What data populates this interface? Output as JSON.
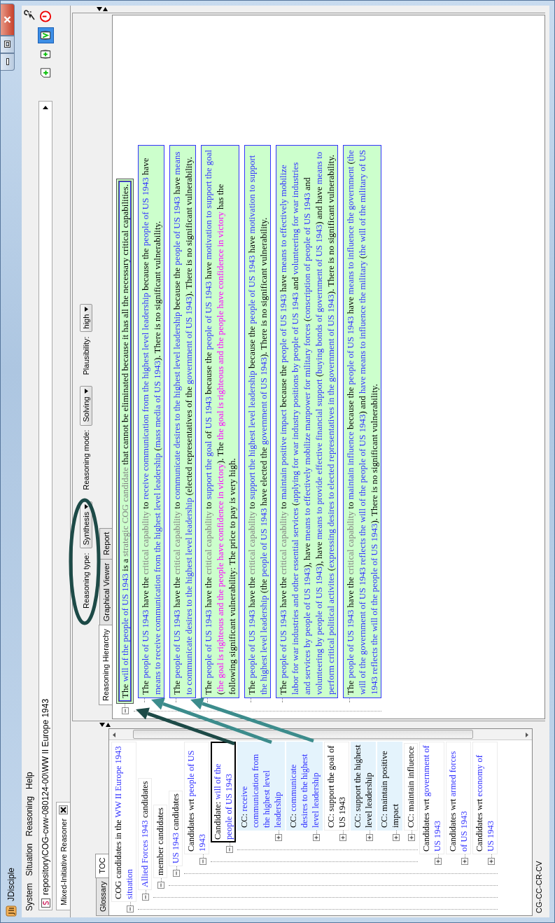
{
  "window": {
    "title": "JDisciple"
  },
  "menu": [
    "System",
    "Situation",
    "Reasoning",
    "Help"
  ],
  "path_field": {
    "value": "repository\\COG-cww-080124-00\\WW II Europe 1943"
  },
  "toolbar": [
    {
      "kind": "new-document",
      "selected": false
    },
    {
      "kind": "add-step",
      "selected": false
    },
    {
      "kind": "check-step",
      "selected": true
    },
    {
      "kind": "stop",
      "selected": false
    }
  ],
  "document_tabs": [
    {
      "label": "Mixed-Initiative Reasoner",
      "selected": true,
      "closable": true
    }
  ],
  "left_panel": {
    "tabs": [
      {
        "label": "Glossary",
        "selected": false
      },
      {
        "label": "TOC",
        "selected": true
      }
    ],
    "tree": [
      {
        "expanded": true,
        "selected": false,
        "highlighted": false,
        "segments": [
          {
            "text": "COG candidates in the ",
            "kind": "plain"
          },
          {
            "text": "WW II Europe 1943 situation",
            "kind": "concept"
          }
        ],
        "children": [
          {
            "expanded": true,
            "selected": false,
            "highlighted": false,
            "segments": [
              {
                "text": "Allied Forces 1943",
                "kind": "concept"
              },
              {
                "text": " candidates",
                "kind": "plain"
              }
            ],
            "children": [
              {
                "expanded": true,
                "selected": false,
                "highlighted": false,
                "segments": [
                  {
                    "text": "member candidates",
                    "kind": "plain"
                  }
                ],
                "children": [
                  {
                    "expanded": true,
                    "selected": false,
                    "highlighted": false,
                    "segments": [
                      {
                        "text": "US 1943",
                        "kind": "concept"
                      },
                      {
                        "text": " candidates",
                        "kind": "plain"
                      }
                    ],
                    "children": [
                      {
                        "expanded": true,
                        "selected": false,
                        "highlighted": false,
                        "segments": [
                          {
                            "text": "Candidates wrt ",
                            "kind": "plain"
                          },
                          {
                            "text": "people of US 1943",
                            "kind": "concept"
                          }
                        ],
                        "children": [
                          {
                            "expanded": true,
                            "selected": true,
                            "highlighted": false,
                            "segments": [
                              {
                                "text": "Candidate: ",
                                "kind": "plain"
                              },
                              {
                                "text": "will of the people of US 1943",
                                "kind": "concept"
                              }
                            ],
                            "children": [
                              {
                                "expanded": false,
                                "selected": false,
                                "highlighted": true,
                                "segments": [
                                  {
                                    "text": "CC: ",
                                    "kind": "plain"
                                  },
                                  {
                                    "text": "receive communication from the highest level leadership",
                                    "kind": "concept"
                                  }
                                ]
                              },
                              {
                                "expanded": false,
                                "selected": false,
                                "highlighted": true,
                                "segments": [
                                  {
                                    "text": "CC: ",
                                    "kind": "plain"
                                  },
                                  {
                                    "text": "communicate desires to the highest level leadership",
                                    "kind": "concept"
                                  }
                                ]
                              },
                              {
                                "expanded": false,
                                "selected": false,
                                "highlighted": false,
                                "segments": [
                                  {
                                    "text": "CC: support the goal of US 1943",
                                    "kind": "plain"
                                  }
                                ]
                              },
                              {
                                "expanded": false,
                                "selected": false,
                                "highlighted": true,
                                "segments": [
                                  {
                                    "text": "CC: support the highest level leadership",
                                    "kind": "plain"
                                  }
                                ]
                              },
                              {
                                "expanded": false,
                                "selected": false,
                                "highlighted": true,
                                "segments": [
                                  {
                                    "text": "CC: maintain positive impact",
                                    "kind": "plain"
                                  }
                                ]
                              },
                              {
                                "expanded": false,
                                "selected": false,
                                "highlighted": false,
                                "segments": [
                                  {
                                    "text": "CC: maintain influence",
                                    "kind": "plain"
                                  }
                                ]
                              }
                            ]
                          }
                        ]
                      },
                      {
                        "expanded": false,
                        "selected": false,
                        "highlighted": false,
                        "segments": [
                          {
                            "text": "Candidates wrt ",
                            "kind": "plain"
                          },
                          {
                            "text": "government of US 1943",
                            "kind": "concept"
                          }
                        ]
                      },
                      {
                        "expanded": false,
                        "selected": false,
                        "highlighted": false,
                        "segments": [
                          {
                            "text": "Candidates wrt ",
                            "kind": "plain"
                          },
                          {
                            "text": "armed forces of US 1943",
                            "kind": "concept"
                          }
                        ]
                      },
                      {
                        "expanded": false,
                        "selected": false,
                        "highlighted": false,
                        "segments": [
                          {
                            "text": "Candidates wrt ",
                            "kind": "plain"
                          },
                          {
                            "text": "economy of US 1943",
                            "kind": "concept"
                          }
                        ]
                      }
                    ]
                  }
                ]
              }
            ]
          }
        ]
      }
    ],
    "status": "CG-CC-CR-CV"
  },
  "right_panel": {
    "reasoning_type": {
      "label": "Reasoning type:",
      "value": "Synthesis"
    },
    "reasoning_mode": {
      "label": "Reasoning mode:",
      "value": "Solving"
    },
    "plausibility": {
      "label": "Plausibility:",
      "value": "high"
    },
    "tabs": [
      {
        "label": "Reasoning Hierarchy",
        "selected": true
      },
      {
        "label": "Graphical Viewer",
        "selected": false
      },
      {
        "label": "Report",
        "selected": false
      }
    ],
    "hierarchy": {
      "root": {
        "expanded": true,
        "selected": true,
        "segments": [
          {
            "text": "The ",
            "kind": "plain"
          },
          {
            "text": "will of the people of US 1943",
            "kind": "concept"
          },
          {
            "text": " is a ",
            "kind": "plain"
          },
          {
            "text": "strategic COG candidate",
            "kind": "feature"
          },
          {
            "text": " that cannot be eliminated because it has all the necessary critical capabilities.",
            "kind": "plain"
          }
        ]
      },
      "children": [
        {
          "selected": false,
          "segments": [
            {
              "text": "The ",
              "kind": "plain"
            },
            {
              "text": "people of US 1943",
              "kind": "concept"
            },
            {
              "text": " have the ",
              "kind": "plain"
            },
            {
              "text": "critical capability",
              "kind": "feature"
            },
            {
              "text": " to ",
              "kind": "plain"
            },
            {
              "text": "receive communication from the highest level leadership",
              "kind": "concept"
            },
            {
              "text": " because the ",
              "kind": "plain"
            },
            {
              "text": "people of US 1943",
              "kind": "concept"
            },
            {
              "text": " have ",
              "kind": "plain"
            },
            {
              "text": "means to receive communication from the highest level leadership",
              "kind": "concept"
            },
            {
              "text": " (",
              "kind": "plain"
            },
            {
              "text": "mass media of US 1943",
              "kind": "concept"
            },
            {
              "text": "). There is no significant vulnerability.",
              "kind": "plain"
            }
          ]
        },
        {
          "selected": false,
          "segments": [
            {
              "text": "The ",
              "kind": "plain"
            },
            {
              "text": "people of US 1943",
              "kind": "concept"
            },
            {
              "text": " have the ",
              "kind": "plain"
            },
            {
              "text": "critical capability",
              "kind": "feature"
            },
            {
              "text": " to ",
              "kind": "plain"
            },
            {
              "text": "communicate desires to the highest level leadership",
              "kind": "concept"
            },
            {
              "text": " because the ",
              "kind": "plain"
            },
            {
              "text": "people of US 1943",
              "kind": "concept"
            },
            {
              "text": " have ",
              "kind": "plain"
            },
            {
              "text": "means to communicate desires to the highest level leadership",
              "kind": "concept"
            },
            {
              "text": " (elected representatives of the ",
              "kind": "plain"
            },
            {
              "text": "government of US 1943",
              "kind": "concept"
            },
            {
              "text": "). There is no significant vulnerability.",
              "kind": "plain"
            }
          ]
        },
        {
          "selected": false,
          "segments": [
            {
              "text": "The ",
              "kind": "plain"
            },
            {
              "text": "people of US 1943",
              "kind": "concept"
            },
            {
              "text": " have the ",
              "kind": "plain"
            },
            {
              "text": "critical capability",
              "kind": "feature"
            },
            {
              "text": " to ",
              "kind": "plain"
            },
            {
              "text": "support the goal",
              "kind": "concept"
            },
            {
              "text": " of ",
              "kind": "plain"
            },
            {
              "text": "US 1943",
              "kind": "concept"
            },
            {
              "text": " because the ",
              "kind": "plain"
            },
            {
              "text": "people of US 1943",
              "kind": "concept"
            },
            {
              "text": " have ",
              "kind": "plain"
            },
            {
              "text": "motivation to support the goal",
              "kind": "concept"
            },
            {
              "text": " (",
              "kind": "plain"
            },
            {
              "text": "the goal is righteous and the people have confidence in victory",
              "kind": "emphasis"
            },
            {
              "text": "). The ",
              "kind": "plain"
            },
            {
              "text": "the goal is righteous and the people have confidence in victory",
              "kind": "emphasis"
            },
            {
              "text": " has the following significant vulnerability: The price to pay is very high.",
              "kind": "plain"
            }
          ]
        },
        {
          "selected": false,
          "segments": [
            {
              "text": "The ",
              "kind": "plain"
            },
            {
              "text": "people of US 1943",
              "kind": "concept"
            },
            {
              "text": " have the ",
              "kind": "plain"
            },
            {
              "text": "critical capability",
              "kind": "feature"
            },
            {
              "text": " to ",
              "kind": "plain"
            },
            {
              "text": "support the highest level leadership",
              "kind": "concept"
            },
            {
              "text": " because the ",
              "kind": "plain"
            },
            {
              "text": "people of US 1943",
              "kind": "concept"
            },
            {
              "text": " have ",
              "kind": "plain"
            },
            {
              "text": "motivation to support the highest level leadership",
              "kind": "concept"
            },
            {
              "text": " (the ",
              "kind": "plain"
            },
            {
              "text": "people of US 1943",
              "kind": "concept"
            },
            {
              "text": " have elected the ",
              "kind": "plain"
            },
            {
              "text": "government of US 1943",
              "kind": "concept"
            },
            {
              "text": "). There is no significant vulnerability.",
              "kind": "plain"
            }
          ]
        },
        {
          "selected": false,
          "segments": [
            {
              "text": "The ",
              "kind": "plain"
            },
            {
              "text": "people of US 1943",
              "kind": "concept"
            },
            {
              "text": " have the ",
              "kind": "plain"
            },
            {
              "text": "critical capability",
              "kind": "feature"
            },
            {
              "text": " to ",
              "kind": "plain"
            },
            {
              "text": "maintain positive impact",
              "kind": "concept"
            },
            {
              "text": " because the ",
              "kind": "plain"
            },
            {
              "text": "people of US 1943",
              "kind": "concept"
            },
            {
              "text": " have ",
              "kind": "plain"
            },
            {
              "text": "means to effectively mobilize labor for war industries and other essential services",
              "kind": "concept"
            },
            {
              "text": " (",
              "kind": "plain"
            },
            {
              "text": "applying for war industry positions by people of US 1943",
              "kind": "concept"
            },
            {
              "text": " and ",
              "kind": "plain"
            },
            {
              "text": "volunteering for war industries and services by people of US 1943",
              "kind": "concept"
            },
            {
              "text": "), have ",
              "kind": "plain"
            },
            {
              "text": "means to effectively mobilize manpower for military forces",
              "kind": "concept"
            },
            {
              "text": " (",
              "kind": "plain"
            },
            {
              "text": "conscription of people of US 1943",
              "kind": "concept"
            },
            {
              "text": " and ",
              "kind": "plain"
            },
            {
              "text": "volunteering by people of US 1943",
              "kind": "concept"
            },
            {
              "text": "), have ",
              "kind": "plain"
            },
            {
              "text": "means to provide effective financial support",
              "kind": "concept"
            },
            {
              "text": " (",
              "kind": "plain"
            },
            {
              "text": "buying bonds of government of US 1943",
              "kind": "concept"
            },
            {
              "text": ") and have ",
              "kind": "plain"
            },
            {
              "text": "means to perform critical political activites",
              "kind": "concept"
            },
            {
              "text": " (",
              "kind": "plain"
            },
            {
              "text": "expressing desires to elected representatives in the government of US 1943",
              "kind": "concept"
            },
            {
              "text": "). There is no significant vulnerability.",
              "kind": "plain"
            }
          ]
        },
        {
          "selected": false,
          "segments": [
            {
              "text": "The ",
              "kind": "plain"
            },
            {
              "text": "people of US 1943",
              "kind": "concept"
            },
            {
              "text": " have the ",
              "kind": "plain"
            },
            {
              "text": "critical capability",
              "kind": "feature"
            },
            {
              "text": " to ",
              "kind": "plain"
            },
            {
              "text": "maintain influence",
              "kind": "concept"
            },
            {
              "text": " because the ",
              "kind": "plain"
            },
            {
              "text": "people of US 1943",
              "kind": "concept"
            },
            {
              "text": " have ",
              "kind": "plain"
            },
            {
              "text": "means to influence the government",
              "kind": "concept"
            },
            {
              "text": " (",
              "kind": "plain"
            },
            {
              "text": "the will of the government of US 1943 reflects the will of the people of US 1943",
              "kind": "concept"
            },
            {
              "text": ") and ",
              "kind": "plain"
            },
            {
              "text": "have means to influence the military",
              "kind": "concept"
            },
            {
              "text": " (",
              "kind": "plain"
            },
            {
              "text": "the will of the military of US 1943 reflects the will of the people of US 1943",
              "kind": "concept"
            },
            {
              "text": "). There is no significant vulnerability.",
              "kind": "plain"
            }
          ]
        }
      ]
    }
  }
}
